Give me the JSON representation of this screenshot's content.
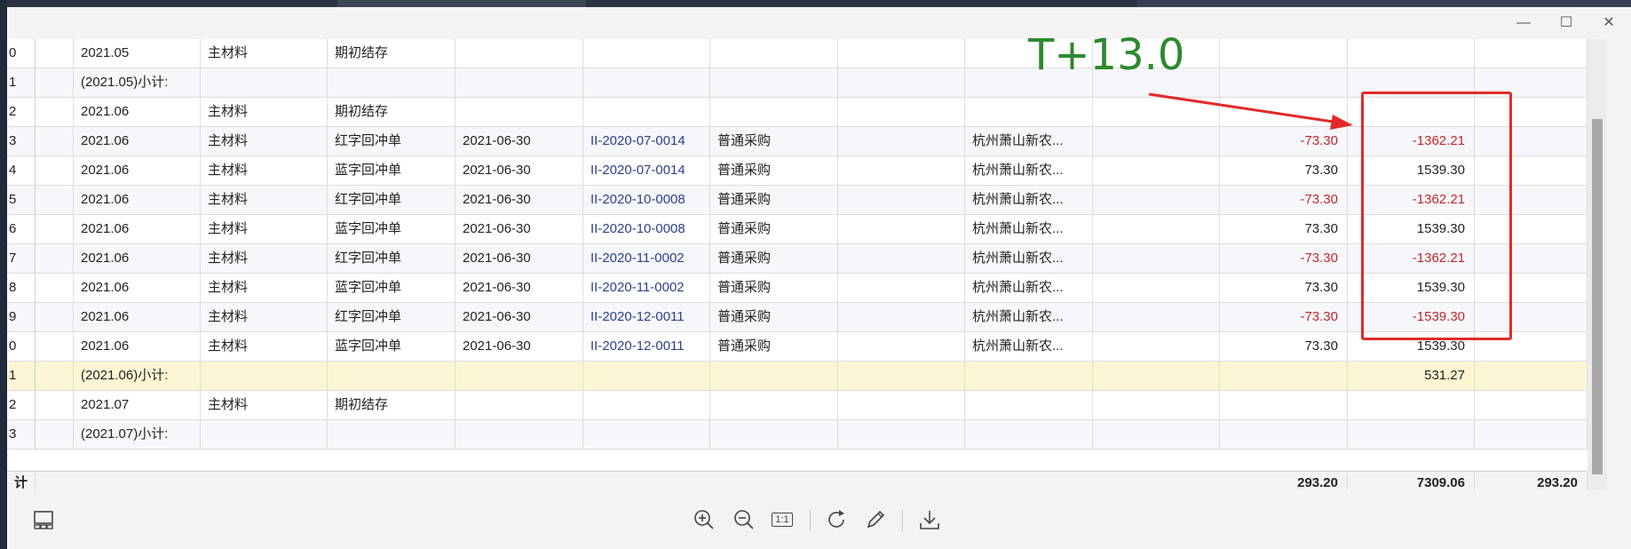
{
  "window": {
    "minimize": "—",
    "maximize": "☐",
    "close": "✕"
  },
  "annotation": {
    "label": "T+13.0"
  },
  "left_strip": [
    "0",
    "1",
    "2",
    "3",
    "4",
    "5",
    "6",
    "7",
    "8",
    "9",
    "0",
    "1",
    "2",
    "3",
    "计"
  ],
  "rows": [
    {
      "period": "2021.05",
      "material": "主材料",
      "type": "期初结存",
      "date": "",
      "doc": "",
      "purchase": "",
      "supplier": "",
      "qty": "",
      "amount": "",
      "style": "normal"
    },
    {
      "period": "(2021.05)小计:",
      "material": "",
      "type": "",
      "date": "",
      "doc": "",
      "purchase": "",
      "supplier": "",
      "qty": "",
      "amount": "",
      "style": "alt"
    },
    {
      "period": "2021.06",
      "material": "主材料",
      "type": "期初结存",
      "date": "",
      "doc": "",
      "purchase": "",
      "supplier": "",
      "qty": "",
      "amount": "",
      "style": "normal"
    },
    {
      "period": "2021.06",
      "material": "主材料",
      "type": "红字回冲单",
      "date": "2021-06-30",
      "doc": "II-2020-07-0014",
      "purchase": "普通采购",
      "supplier": "杭州萧山新农...",
      "qty": "-73.30",
      "amount": "-1362.21",
      "style": "alt"
    },
    {
      "period": "2021.06",
      "material": "主材料",
      "type": "蓝字回冲单",
      "date": "2021-06-30",
      "doc": "II-2020-07-0014",
      "purchase": "普通采购",
      "supplier": "杭州萧山新农...",
      "qty": "73.30",
      "amount": "1539.30",
      "style": "normal"
    },
    {
      "period": "2021.06",
      "material": "主材料",
      "type": "红字回冲单",
      "date": "2021-06-30",
      "doc": "II-2020-10-0008",
      "purchase": "普通采购",
      "supplier": "杭州萧山新农...",
      "qty": "-73.30",
      "amount": "-1362.21",
      "style": "alt"
    },
    {
      "period": "2021.06",
      "material": "主材料",
      "type": "蓝字回冲单",
      "date": "2021-06-30",
      "doc": "II-2020-10-0008",
      "purchase": "普通采购",
      "supplier": "杭州萧山新农...",
      "qty": "73.30",
      "amount": "1539.30",
      "style": "normal"
    },
    {
      "period": "2021.06",
      "material": "主材料",
      "type": "红字回冲单",
      "date": "2021-06-30",
      "doc": "II-2020-11-0002",
      "purchase": "普通采购",
      "supplier": "杭州萧山新农...",
      "qty": "-73.30",
      "amount": "-1362.21",
      "style": "alt"
    },
    {
      "period": "2021.06",
      "material": "主材料",
      "type": "蓝字回冲单",
      "date": "2021-06-30",
      "doc": "II-2020-11-0002",
      "purchase": "普通采购",
      "supplier": "杭州萧山新农...",
      "qty": "73.30",
      "amount": "1539.30",
      "style": "normal"
    },
    {
      "period": "2021.06",
      "material": "主材料",
      "type": "红字回冲单",
      "date": "2021-06-30",
      "doc": "II-2020-12-0011",
      "purchase": "普通采购",
      "supplier": "杭州萧山新农...",
      "qty": "-73.30",
      "amount": "-1539.30",
      "style": "alt"
    },
    {
      "period": "2021.06",
      "material": "主材料",
      "type": "蓝字回冲单",
      "date": "2021-06-30",
      "doc": "II-2020-12-0011",
      "purchase": "普通采购",
      "supplier": "杭州萧山新农...",
      "qty": "73.30",
      "amount": "1539.30",
      "style": "normal"
    },
    {
      "period": "(2021.06)小计:",
      "material": "",
      "type": "",
      "date": "",
      "doc": "",
      "purchase": "",
      "supplier": "",
      "qty": "",
      "amount": "531.27",
      "style": "subtotal"
    },
    {
      "period": "2021.07",
      "material": "主材料",
      "type": "期初结存",
      "date": "",
      "doc": "",
      "purchase": "",
      "supplier": "",
      "qty": "",
      "amount": "",
      "style": "normal"
    },
    {
      "period": "(2021.07)小计:",
      "material": "",
      "type": "",
      "date": "",
      "doc": "",
      "purchase": "",
      "supplier": "",
      "qty": "",
      "amount": "",
      "style": "alt"
    }
  ],
  "total": {
    "label": "计",
    "qty": "293.20",
    "amount": "7309.06",
    "extra": "293.20"
  },
  "colors": {
    "negative": "#c0282a",
    "doc_link": "#2b3f8c",
    "annotation_green": "#2c8a2c",
    "annotation_red": "#e22a2a",
    "subtotal_bg": "#fdf6d5"
  },
  "toolbar": {
    "icons": [
      "layout-icon",
      "zoom-in-icon",
      "zoom-out-icon",
      "actual-size-icon",
      "rotate-icon",
      "edit-icon",
      "download-icon"
    ],
    "actual_size_label": "1:1"
  }
}
